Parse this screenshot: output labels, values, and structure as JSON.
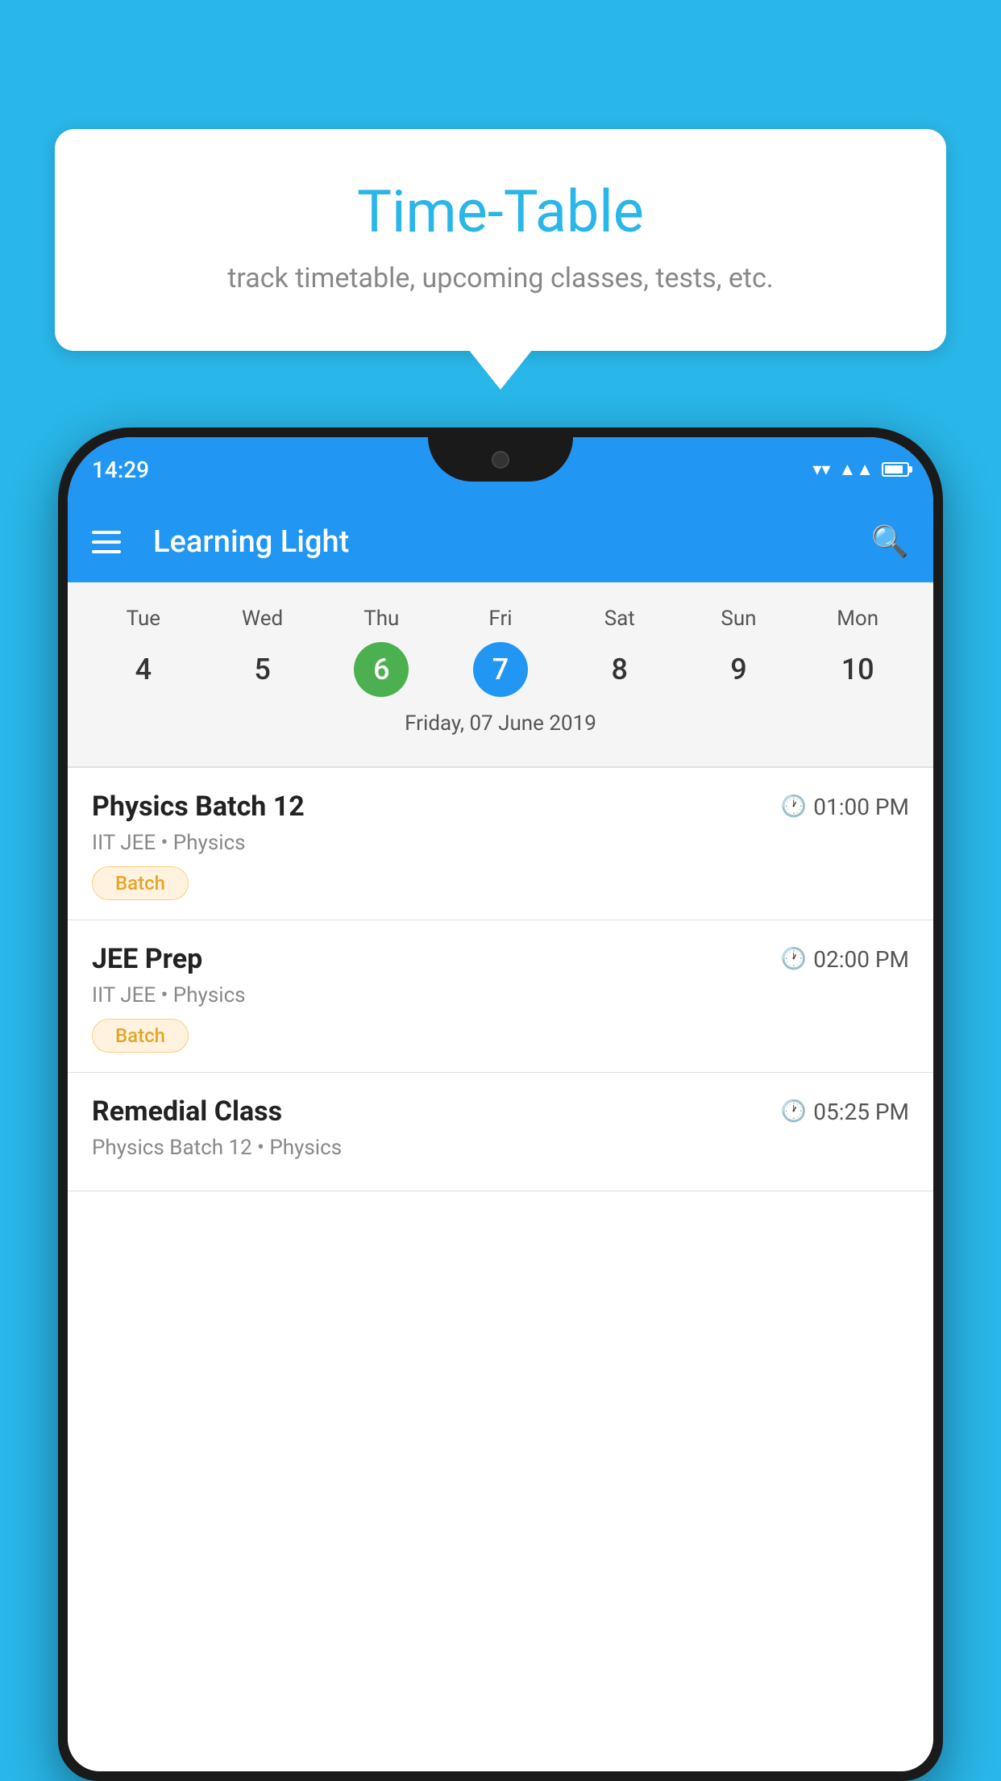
{
  "background_color": "#29B6E8",
  "tooltip": {
    "title": "Time-Table",
    "subtitle": "track timetable, upcoming classes, tests, etc."
  },
  "phone": {
    "status_bar": {
      "time": "14:29"
    },
    "app_bar": {
      "title": "Learning Light"
    },
    "calendar": {
      "days": [
        {
          "name": "Tue",
          "number": "4",
          "state": "normal"
        },
        {
          "name": "Wed",
          "number": "5",
          "state": "normal"
        },
        {
          "name": "Thu",
          "number": "6",
          "state": "today"
        },
        {
          "name": "Fri",
          "number": "7",
          "state": "selected"
        },
        {
          "name": "Sat",
          "number": "8",
          "state": "normal"
        },
        {
          "name": "Sun",
          "number": "9",
          "state": "normal"
        },
        {
          "name": "Mon",
          "number": "10",
          "state": "normal"
        }
      ],
      "selected_date_label": "Friday, 07 June 2019"
    },
    "schedule": [
      {
        "title": "Physics Batch 12",
        "time": "01:00 PM",
        "meta": "IIT JEE • Physics",
        "tag": "Batch"
      },
      {
        "title": "JEE Prep",
        "time": "02:00 PM",
        "meta": "IIT JEE • Physics",
        "tag": "Batch"
      },
      {
        "title": "Remedial Class",
        "time": "05:25 PM",
        "meta": "Physics Batch 12 • Physics",
        "tag": ""
      }
    ]
  }
}
